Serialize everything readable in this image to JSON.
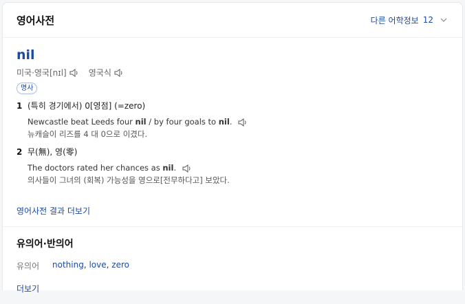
{
  "header": {
    "title": "영어사전",
    "more_label": "다른 어학정보",
    "more_count": "12"
  },
  "entry": {
    "word": "nil",
    "pron_us_uk": "미국·영국[nɪl]",
    "pron_kr": "영국식",
    "pos": "명사",
    "senses": [
      {
        "num": "1",
        "meaning": "(특히 경기에서) 0[영점] (=zero)",
        "example_en_pre": "Newcastle beat Leeds four ",
        "example_en_bold1": "nil",
        "example_en_mid": " / by four goals to ",
        "example_en_bold2": "nil",
        "example_en_post": ".",
        "example_kr": "뉴캐슬이 리즈를 4 대 0으로 이겼다."
      },
      {
        "num": "2",
        "meaning": "무(無), 영(零)",
        "example_en_pre": "The doctors rated her chances as ",
        "example_en_bold1": "nil",
        "example_en_post": ".",
        "example_kr": "의사들이 그녀의 (회복) 가능성을 영으로[전무하다고] 보았다."
      }
    ],
    "more_link": "영어사전 결과 더보기"
  },
  "synonyms": {
    "title": "유의어·반의어",
    "label": "유의어",
    "words": [
      "nothing",
      "love",
      "zero"
    ],
    "more": "더보기"
  },
  "colors": {
    "link": "#1a4aa6"
  },
  "icons": [
    "speaker-icon",
    "chevron-down-icon"
  ]
}
